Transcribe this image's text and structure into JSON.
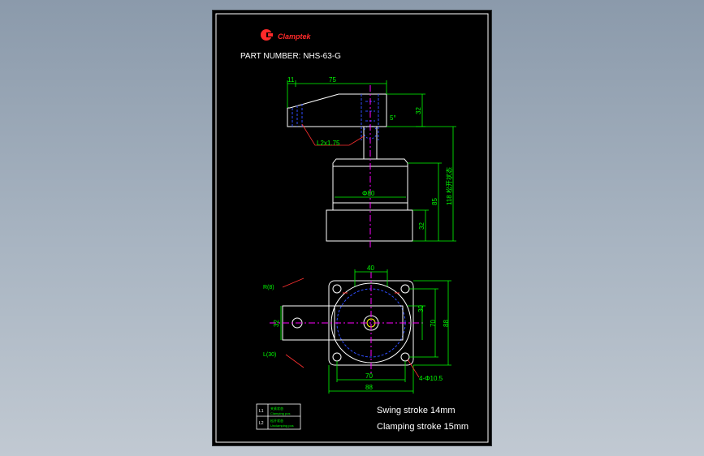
{
  "drawing": {
    "brand": "Clamptek",
    "part_number": "PART NUMBER:  NHS-63-G",
    "side_view": {
      "dim_top_a": "11",
      "dim_top_b": "75",
      "dim_arm_height": "32",
      "angle": "5°",
      "thread": "L2x1.75",
      "dim_total": "118 松开状态",
      "dim_body": "85",
      "dim_flange": "32",
      "body_diameter": "Φ80"
    },
    "plan_view": {
      "dim_top": "40",
      "radius_upper": "R(8)",
      "radius_lower": "L(30)",
      "dim_arm_width": "32",
      "dim_hole_a": "30",
      "dim_hole_b": "70",
      "dim_outer_v": "88",
      "dim_bottom_inner": "70",
      "dim_bottom_outer": "88",
      "holes": "4-Φ10.5"
    },
    "legend": [
      {
        "code": "L1",
        "line1": "夹紧状态",
        "line2": "Clamping pos"
      },
      {
        "code": "L2",
        "line1": "松开状态",
        "line2": "Unclamping pos"
      }
    ],
    "notes": {
      "swing": "Swing stroke 14mm",
      "clamping": "Clamping stroke 15mm"
    },
    "colors": {
      "outline": "#ffffff",
      "dimension": "#00ff00",
      "hidden": "#2f4dff",
      "center": "#ff00ff",
      "annotation": "#ff3030",
      "brand": "#ff2a2a"
    }
  }
}
